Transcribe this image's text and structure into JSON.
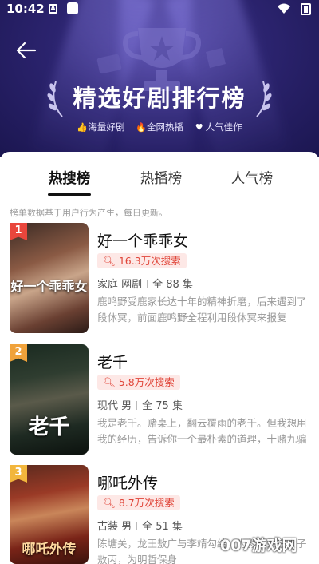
{
  "status_bar": {
    "time": "10:42",
    "app_icon_letter": "A"
  },
  "hero": {
    "title": "精选好剧排行榜",
    "tags": [
      {
        "icon": "thumbs-up-icon",
        "label": "海量好剧"
      },
      {
        "icon": "fire-icon",
        "label": "全网热播"
      },
      {
        "icon": "heart-icon",
        "label": "人气佳作"
      }
    ],
    "bg_color": "#2c2470"
  },
  "tabs": [
    {
      "label": "热搜榜",
      "active": true
    },
    {
      "label": "热播榜",
      "active": false
    },
    {
      "label": "人气榜",
      "active": false
    }
  ],
  "note": "榜单数据基于用户行为产生，每日更新。",
  "items": [
    {
      "rank": "1",
      "rank_color": "#e9463c",
      "poster_text": "好一个乖乖女",
      "title": "好一个乖乖女",
      "searches": "16.3万次搜索",
      "genre": "家庭 网剧",
      "episodes": "全 88 集",
      "desc": "鹿鸣野受鹿家长达十年的精神折磨，后来遇到了段休冥，前面鹿鸣野全程利用段休冥来报复"
    },
    {
      "rank": "2",
      "rank_color": "#f0a23a",
      "poster_text": "老千",
      "title": "老千",
      "searches": "5.8万次搜索",
      "genre": "现代 男",
      "episodes": "全 75 集",
      "desc": "我是老千。赌桌上，翻云覆雨的老千。但我想用我的经历，告诉你一个最朴素的道理，十赌九骗"
    },
    {
      "rank": "3",
      "rank_color": "#f2b63c",
      "poster_text": "哪吒外传",
      "title": "哪吒外传",
      "searches": "8.7万次搜索",
      "genre": "古装 男",
      "episodes": "全 51 集",
      "desc": "陈塘关，龙王敖广与李靖勾结，为救怒杀三太子敖丙，为明哲保身"
    }
  ],
  "watermark": {
    "text": "007游戏网",
    "sub": "www.007ls.com"
  }
}
